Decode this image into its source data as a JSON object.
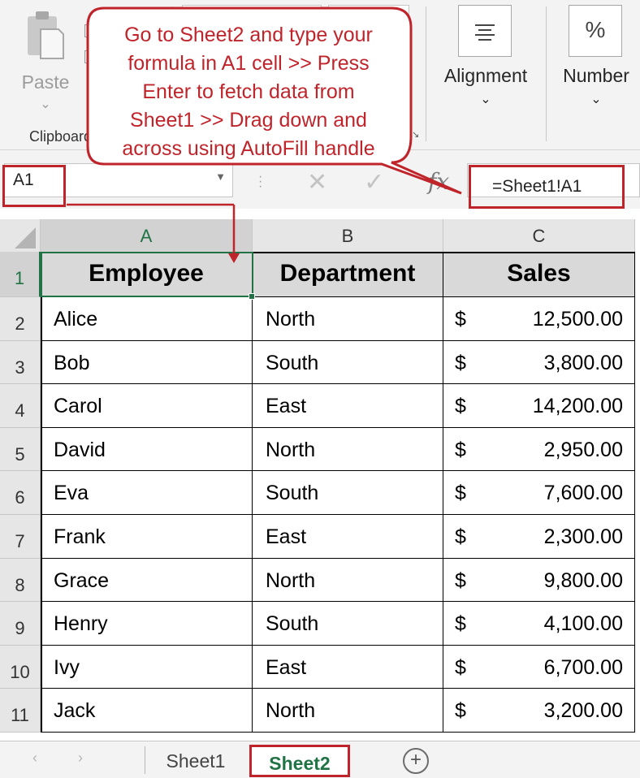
{
  "ribbon": {
    "clipboard": {
      "paste_label": "Paste",
      "group_label": "Clipboard",
      "caret": "⌄"
    },
    "alignment": {
      "label": "Alignment",
      "caret": "⌄"
    },
    "number": {
      "label": "Number",
      "icon_glyph": "%",
      "caret": "⌄"
    },
    "launcher_glyph": "↘"
  },
  "formula_bar": {
    "name_box": "A1",
    "cancel_glyph": "✕",
    "enter_glyph": "✓",
    "fx_glyph": "fx",
    "formula": "=Sheet1!A1"
  },
  "callout": {
    "lines": [
      "Go to Sheet2 and type your",
      "formula in A1 cell >> Press",
      "Enter to fetch data from",
      "Sheet1 >> Drag down and",
      "across using AutoFill handle"
    ],
    "color": "#c0242b"
  },
  "grid": {
    "columns": [
      "A",
      "B",
      "C"
    ],
    "row_numbers": [
      "1",
      "2",
      "3",
      "4",
      "5",
      "6",
      "7",
      "8",
      "9",
      "10",
      "11"
    ],
    "header": [
      "Employee",
      "Department",
      "Sales"
    ],
    "rows": [
      {
        "employee": "Alice",
        "department": "North",
        "currency": "$",
        "sales": "12,500.00"
      },
      {
        "employee": "Bob",
        "department": "South",
        "currency": "$",
        "sales": "3,800.00"
      },
      {
        "employee": "Carol",
        "department": "East",
        "currency": "$",
        "sales": "14,200.00"
      },
      {
        "employee": "David",
        "department": "North",
        "currency": "$",
        "sales": "2,950.00"
      },
      {
        "employee": "Eva",
        "department": "South",
        "currency": "$",
        "sales": "7,600.00"
      },
      {
        "employee": "Frank",
        "department": "East",
        "currency": "$",
        "sales": "2,300.00"
      },
      {
        "employee": "Grace",
        "department": "North",
        "currency": "$",
        "sales": "9,800.00"
      },
      {
        "employee": "Henry",
        "department": "South",
        "currency": "$",
        "sales": "4,100.00"
      },
      {
        "employee": "Ivy",
        "department": "East",
        "currency": "$",
        "sales": "6,700.00"
      },
      {
        "employee": "Jack",
        "department": "North",
        "currency": "$",
        "sales": "3,200.00"
      }
    ],
    "selected_cell": "A1"
  },
  "sheet_tabs": {
    "tabs": [
      "Sheet1",
      "Sheet2"
    ],
    "active": "Sheet2",
    "add_glyph": "+",
    "nav_prev": "◀",
    "nav_next": "▶"
  },
  "colors": {
    "accent_green": "#217346",
    "highlight_red": "#c0242b",
    "header_fill": "#d9d9d9"
  }
}
